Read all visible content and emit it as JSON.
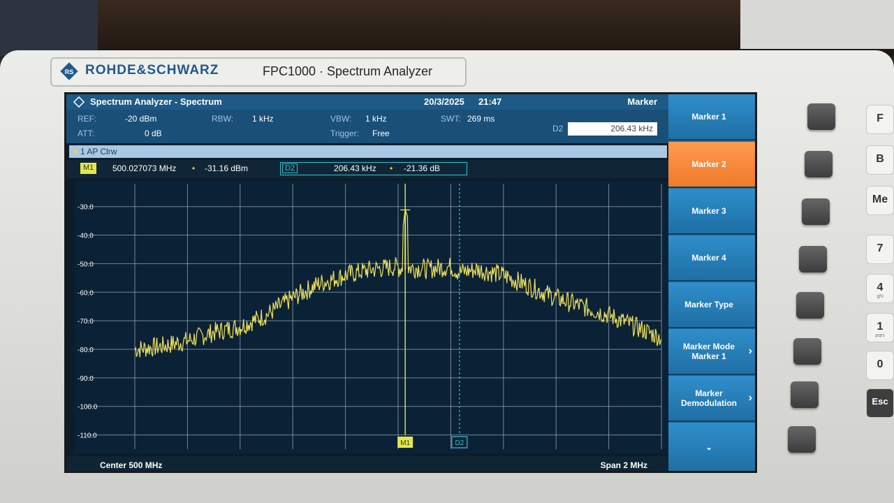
{
  "device": {
    "brand": "ROHDE&SCHWARZ",
    "model": "FPC1000 · Spectrum Analyzer"
  },
  "header": {
    "title": "Spectrum Analyzer - Spectrum",
    "date": "20/3/2025",
    "time": "21:47",
    "menu_title": "Marker"
  },
  "params": {
    "ref_label": "REF:",
    "ref_value": "-20 dBm",
    "att_label": "ATT:",
    "att_value": "0 dB",
    "rbw_label": "RBW:",
    "rbw_value": "1 kHz",
    "vbw_label": "VBW:",
    "vbw_value": "1 kHz",
    "trigger_label": "Trigger:",
    "trigger_value": "Free",
    "swt_label": "SWT:",
    "swt_value": "269 ms",
    "d2_label": "D2",
    "d2_value": "206.43 kHz"
  },
  "trace": {
    "label": "1 AP  Clrw"
  },
  "markers": {
    "m1_tag": "M1",
    "m1_freq": "500.027073 MHz",
    "m1_level": "-31.16 dBm",
    "d2_tag": "D2",
    "d2_freq": "206.43 kHz",
    "d2_level": "-21.36 dB",
    "sep": "•"
  },
  "footer": {
    "center": "Center 500 MHz",
    "span": "Span 2 MHz"
  },
  "softkeys": [
    {
      "label": "Marker 1",
      "active": false,
      "chevron": false
    },
    {
      "label": "Marker 2",
      "active": true,
      "chevron": false
    },
    {
      "label": "Marker 3",
      "active": false,
      "chevron": false
    },
    {
      "label": "Marker 4",
      "active": false,
      "chevron": false
    },
    {
      "label": "Marker Type",
      "active": false,
      "chevron": false
    },
    {
      "label": "Marker Mode Marker 1",
      "active": false,
      "chevron": true
    },
    {
      "label": "Marker Demodulation",
      "active": false,
      "chevron": true
    },
    {
      "label": "⌄",
      "active": false,
      "chevron": false
    }
  ],
  "keypad": {
    "k7": "7",
    "k4": "4",
    "k4_sub": "ghi",
    "k1": "1",
    "k1_sub": "pqrs",
    "k0": "0",
    "esc": "Esc",
    "f": "F",
    "b": "B",
    "m": "Me"
  },
  "colors": {
    "trace": "#f2e35a",
    "marker1": "#e3e84a",
    "delta2": "#2ec5d4",
    "grid": "#c9d6e2",
    "active_key": "#f07a2c"
  },
  "chart_data": {
    "type": "line",
    "xlabel": "Center 500 MHz",
    "ylabel": "",
    "xlim_mhz": [
      499,
      501
    ],
    "ylim": [
      -120,
      -20
    ],
    "y_ticks": [
      "-30.0",
      "-40.0",
      "-50.0",
      "-60.0",
      "-70.0",
      "-80.0",
      "-90.0",
      "-100.0",
      "-110.0"
    ],
    "grid": true,
    "series": [
      {
        "name": "1 AP Clrw",
        "x_mhz": [
          499.0,
          499.1,
          499.2,
          499.3,
          499.4,
          499.5,
          499.6,
          499.7,
          499.8,
          499.9,
          500.0,
          500.027,
          500.1,
          500.2,
          500.23,
          500.3,
          500.4,
          500.5,
          500.6,
          500.7,
          500.8,
          500.9,
          501.0
        ],
        "y_dbm": [
          -80,
          -79,
          -77,
          -74,
          -72,
          -68,
          -62,
          -57,
          -54,
          -52,
          -51,
          -31,
          -52,
          -51,
          -53,
          -52,
          -54,
          -58,
          -62,
          -65,
          -68,
          -72,
          -76
        ]
      }
    ],
    "markers": [
      {
        "name": "M1",
        "x_mhz": 500.027,
        "y_dbm": -31.16
      },
      {
        "name": "D2",
        "x_mhz": 500.233,
        "y_dbm": -52.5
      }
    ]
  }
}
